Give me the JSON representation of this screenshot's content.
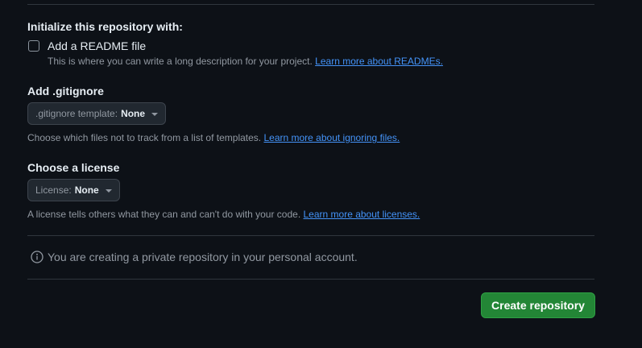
{
  "initialize": {
    "heading": "Initialize this repository with:",
    "readme": {
      "label": "Add a README file",
      "checked": false,
      "help_text": "This is where you can write a long description for your project.",
      "help_link": "Learn more about READMEs."
    }
  },
  "gitignore": {
    "heading": "Add .gitignore",
    "select_prefix": ".gitignore template:",
    "select_value": "None",
    "help_text": "Choose which files not to track from a list of templates.",
    "help_link": "Learn more about ignoring files."
  },
  "license": {
    "heading": "Choose a license",
    "select_prefix": "License:",
    "select_value": "None",
    "help_text": "A license tells others what they can and can't do with your code.",
    "help_link": "Learn more about licenses."
  },
  "notice": {
    "icon": "info-icon",
    "text": "You are creating a private repository in your personal account."
  },
  "actions": {
    "create_label": "Create repository"
  },
  "colors": {
    "background": "#0d1117",
    "link": "#4493f8",
    "primary_button": "#238636"
  }
}
